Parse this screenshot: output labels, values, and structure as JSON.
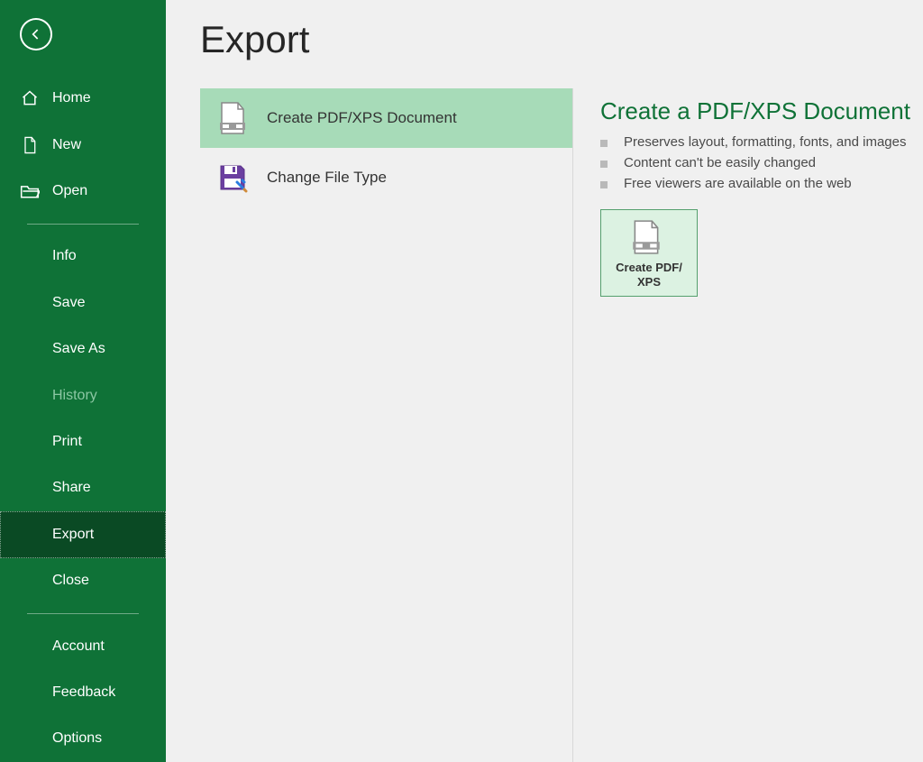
{
  "page": {
    "title": "Export"
  },
  "sidebar": {
    "primary": [
      {
        "label": "Home",
        "icon": "home-icon"
      },
      {
        "label": "New",
        "icon": "file-icon"
      },
      {
        "label": "Open",
        "icon": "folder-icon"
      }
    ],
    "secondary": [
      {
        "label": "Info"
      },
      {
        "label": "Save"
      },
      {
        "label": "Save As"
      },
      {
        "label": "History",
        "disabled": true
      },
      {
        "label": "Print"
      },
      {
        "label": "Share"
      },
      {
        "label": "Export",
        "selected": true
      },
      {
        "label": "Close"
      }
    ],
    "tertiary": [
      {
        "label": "Account"
      },
      {
        "label": "Feedback"
      },
      {
        "label": "Options"
      }
    ]
  },
  "options": [
    {
      "label": "Create PDF/XPS Document",
      "icon": "pdf-doc-icon",
      "selected": true
    },
    {
      "label": "Change File Type",
      "icon": "save-type-icon"
    }
  ],
  "details": {
    "title": "Create a PDF/XPS Document",
    "bullets": [
      "Preserves layout, formatting, fonts, and images",
      "Content can't be easily changed",
      "Free viewers are available on the web"
    ],
    "button_label": "Create PDF/\nXPS"
  }
}
